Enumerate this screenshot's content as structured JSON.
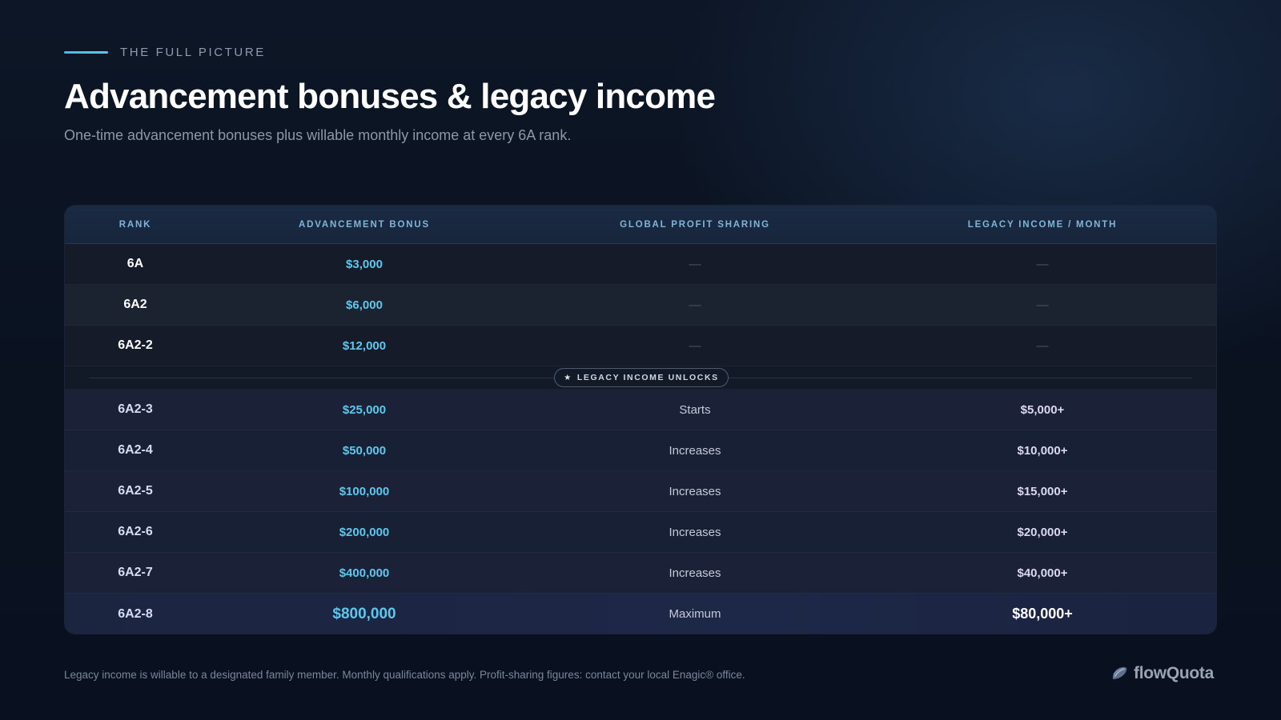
{
  "header": {
    "eyebrow": "THE FULL PICTURE",
    "title": "Advancement bonuses & legacy income",
    "subtitle": "One-time advancement bonuses plus willable monthly income at every 6A rank."
  },
  "table": {
    "columns": [
      "RANK",
      "ADVANCEMENT BONUS",
      "GLOBAL PROFIT SHARING",
      "LEGACY INCOME / MONTH"
    ],
    "rows_before": [
      {
        "rank": "6A",
        "bonus": "$3,000",
        "profit": "—",
        "legacy": "—"
      },
      {
        "rank": "6A2",
        "bonus": "$6,000",
        "profit": "—",
        "legacy": "—"
      },
      {
        "rank": "6A2-2",
        "bonus": "$12,000",
        "profit": "—",
        "legacy": "—"
      }
    ],
    "divider_label": "LEGACY INCOME UNLOCKS",
    "divider_icon": "★",
    "rows_after": [
      {
        "rank": "6A2-3",
        "bonus": "$25,000",
        "profit": "Starts",
        "legacy": "$5,000+"
      },
      {
        "rank": "6A2-4",
        "bonus": "$50,000",
        "profit": "Increases",
        "legacy": "$10,000+"
      },
      {
        "rank": "6A2-5",
        "bonus": "$100,000",
        "profit": "Increases",
        "legacy": "$15,000+"
      },
      {
        "rank": "6A2-6",
        "bonus": "$200,000",
        "profit": "Increases",
        "legacy": "$20,000+"
      },
      {
        "rank": "6A2-7",
        "bonus": "$400,000",
        "profit": "Increases",
        "legacy": "$40,000+"
      },
      {
        "rank": "6A2-8",
        "bonus": "$800,000",
        "profit": "Maximum",
        "legacy": "$80,000+"
      }
    ]
  },
  "footer": {
    "note": "Legacy income is willable to a designated family member. Monthly qualifications apply. Profit-sharing figures: contact your local Enagic® office.",
    "brand": "flowQuota"
  },
  "colors": {
    "accent": "#5cc8ee",
    "background": "#0b1322",
    "header_text": "#7fb5db"
  }
}
